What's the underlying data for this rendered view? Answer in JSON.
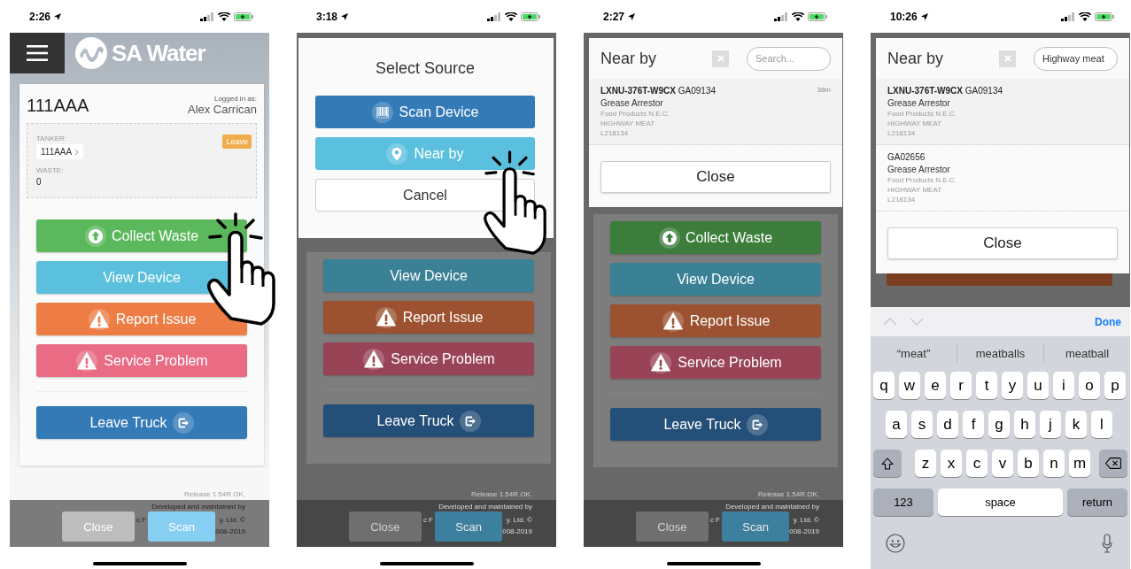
{
  "screens": [
    {
      "kind": "home",
      "status": {
        "time": "2:26"
      },
      "header": {
        "brand": "SA Water"
      },
      "card": {
        "vehicle": "111AAA",
        "login_label": "Logged in as:",
        "user": "Alex Carrican",
        "tanker_label": "TANKER:",
        "tanker": "111AAA",
        "leave": "Leave",
        "waste_label": "WASTE:",
        "waste": "0"
      },
      "actions": [
        {
          "label": "Collect Waste",
          "kind": "upload",
          "color": "#5cb85c"
        },
        {
          "label": "View Device",
          "kind": "plain",
          "color": "#5bc0de"
        },
        {
          "label": "Report Issue",
          "kind": "warning",
          "color": "#ed7d45"
        },
        {
          "label": "Service Problem",
          "kind": "warning",
          "color": "#e96c84"
        },
        {
          "label": "Leave Truck",
          "kind": "exit",
          "color": "#337ab7"
        }
      ],
      "footer": {
        "release": "Release 1.54R OK.",
        "credit": "Developed and maintained by",
        "close": "Close",
        "credit_middle": "c F",
        "scan": "Scan",
        "credit_end": [
          "y. Ltd. ©",
          "008-2019"
        ]
      },
      "gesture": true
    },
    {
      "kind": "select_source",
      "status": {
        "time": "3:18"
      },
      "modal": {
        "title": "Select Source",
        "options": [
          {
            "label": "Scan Device",
            "kind": "barcode"
          },
          {
            "label": "Near by",
            "kind": "pin"
          },
          {
            "label": "Cancel",
            "kind": "cancel"
          }
        ]
      },
      "actions": [
        {
          "label": "View Device",
          "kind": "plain",
          "color": "#3a8196"
        },
        {
          "label": "Report Issue",
          "kind": "warning",
          "color": "#9c5230"
        },
        {
          "label": "Service Problem",
          "kind": "warning",
          "color": "#994456"
        },
        {
          "label": "Leave Truck",
          "kind": "exit",
          "color": "#244f78"
        }
      ],
      "footer": {
        "release": "Release 1.54R OK.",
        "credit": "Developed and maintained by",
        "close": "Close",
        "credit_middle": "c F",
        "scan": "Scan",
        "credit_end": [
          "y. Ltd. ©",
          "008-2019"
        ]
      },
      "gesture": true
    },
    {
      "kind": "nearby",
      "status": {
        "time": "2:27"
      },
      "modal": {
        "title": "Near by",
        "search": {
          "placeholder": "Search..."
        },
        "results": [
          {
            "title": "**LXNU-376T-W9CX** GA09134",
            "type": "Grease Arrestor",
            "category": "Food Products N.E.C.",
            "site": "HIGHWAY MEAT",
            "ref": "L218134",
            "distance": "38m"
          }
        ],
        "close": "Close"
      },
      "actions": [
        {
          "label": "Collect Waste",
          "kind": "upload",
          "color": "#3c7d3c"
        },
        {
          "label": "View Device",
          "kind": "plain",
          "color": "#3a8196"
        },
        {
          "label": "Report Issue",
          "kind": "warning",
          "color": "#9c5230"
        },
        {
          "label": "Service Problem",
          "kind": "warning",
          "color": "#994456"
        },
        {
          "label": "Leave Truck",
          "kind": "exit",
          "color": "#244f78"
        }
      ],
      "footer": {
        "release": "Release 1.54R OK.",
        "credit": "Developed and maintained by",
        "close": "Close",
        "credit_middle": "c F",
        "scan": "Scan",
        "credit_end": [
          "y. Ltd. ©",
          "008-2019"
        ]
      }
    },
    {
      "kind": "nearby",
      "status": {
        "time": "10:26"
      },
      "modal": {
        "title": "Near by",
        "search": {
          "value": "Highway meat"
        },
        "results": [
          {
            "title": "**LXNU-376T-W9CX** GA09134",
            "type": "Grease Arrestor",
            "category": "Food Products N.E.C.",
            "site": "HIGHWAY MEAT",
            "ref": "L218134"
          },
          {
            "title": "GA02656",
            "type": "Grease Arrestor",
            "category": "Food Products N.E.C.",
            "site": "HIGHWAY MEAT",
            "ref": "L218134"
          }
        ],
        "close": "Close"
      },
      "keyboard": {
        "done": "Done",
        "suggestions": [
          "“meat”",
          "meatballs",
          "meatball"
        ],
        "rows": [
          [
            "q",
            "w",
            "e",
            "r",
            "t",
            "y",
            "u",
            "i",
            "o",
            "p"
          ],
          [
            "a",
            "s",
            "d",
            "f",
            "g",
            "h",
            "j",
            "k",
            "l"
          ],
          [
            "z",
            "x",
            "c",
            "v",
            "b",
            "n",
            "m"
          ]
        ],
        "numbers": "123",
        "space": "space",
        "return": "return"
      }
    }
  ]
}
